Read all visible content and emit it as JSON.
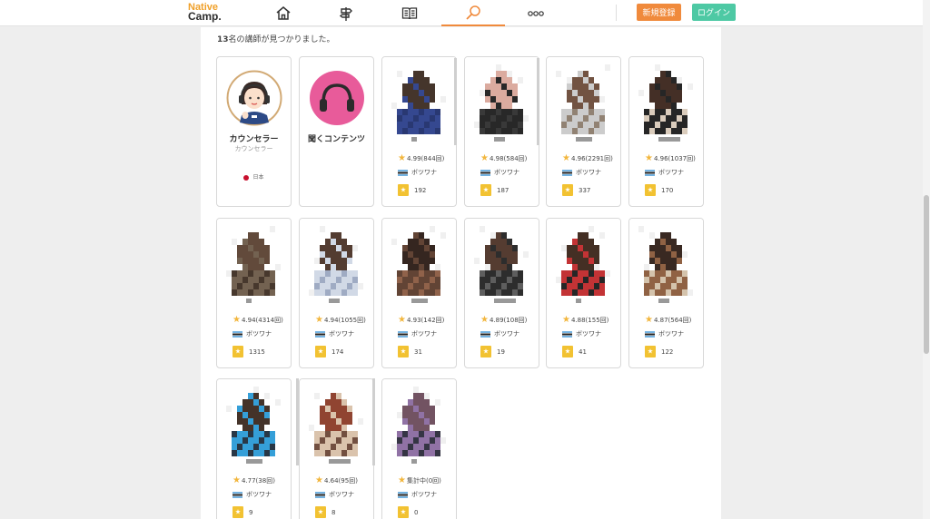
{
  "header": {
    "logo_line1": "Native",
    "logo_line2": "Camp.",
    "nav_icons": [
      "home-icon",
      "signpost-icon",
      "book-icon",
      "search-icon",
      "more-icon"
    ],
    "active_nav": "search-icon",
    "signup_label": "新規登録",
    "login_label": "ログイン"
  },
  "results": {
    "count": "13",
    "suffix": "名の講師が見つかりました。"
  },
  "special_cards": [
    {
      "name": "カウンセラー",
      "sub": "カウンセラー",
      "country": "日本",
      "icon": "counselor-avatar-icon"
    },
    {
      "name": "聞くコンテンツ",
      "icon": "headphones-icon"
    }
  ],
  "teachers": [
    {
      "rating": "4.99(844回)",
      "country": "ボツワナ",
      "favorites": "192"
    },
    {
      "rating": "4.98(584回)",
      "country": "ボツワナ",
      "favorites": "187"
    },
    {
      "rating": "4.96(2291回)",
      "country": "ボツワナ",
      "favorites": "337"
    },
    {
      "rating": "4.96(1037回)",
      "country": "ボツワナ",
      "favorites": "170"
    },
    {
      "rating": "4.94(4314回)",
      "country": "ボツワナ",
      "favorites": "1315"
    },
    {
      "rating": "4.94(1055回)",
      "country": "ボツワナ",
      "favorites": "174"
    },
    {
      "rating": "4.93(142回)",
      "country": "ボツワナ",
      "favorites": "31"
    },
    {
      "rating": "4.89(108回)",
      "country": "ボツワナ",
      "favorites": "19"
    },
    {
      "rating": "4.88(155回)",
      "country": "ボツワナ",
      "favorites": "41"
    },
    {
      "rating": "4.87(564回)",
      "country": "ボツワナ",
      "favorites": "122"
    },
    {
      "rating": "4.77(38回)",
      "country": "ボツワナ",
      "favorites": "9"
    },
    {
      "rating": "4.64(95回)",
      "country": "ボツワナ",
      "favorites": "8"
    },
    {
      "rating": "集計中(0回)",
      "country": "ボツワナ",
      "favorites": "0"
    }
  ],
  "colors": {
    "brand_orange": "#f08a3c",
    "login_green": "#4ec9a4",
    "star_yellow": "#f2b63d",
    "counselor_pink": "#e85b9a"
  }
}
